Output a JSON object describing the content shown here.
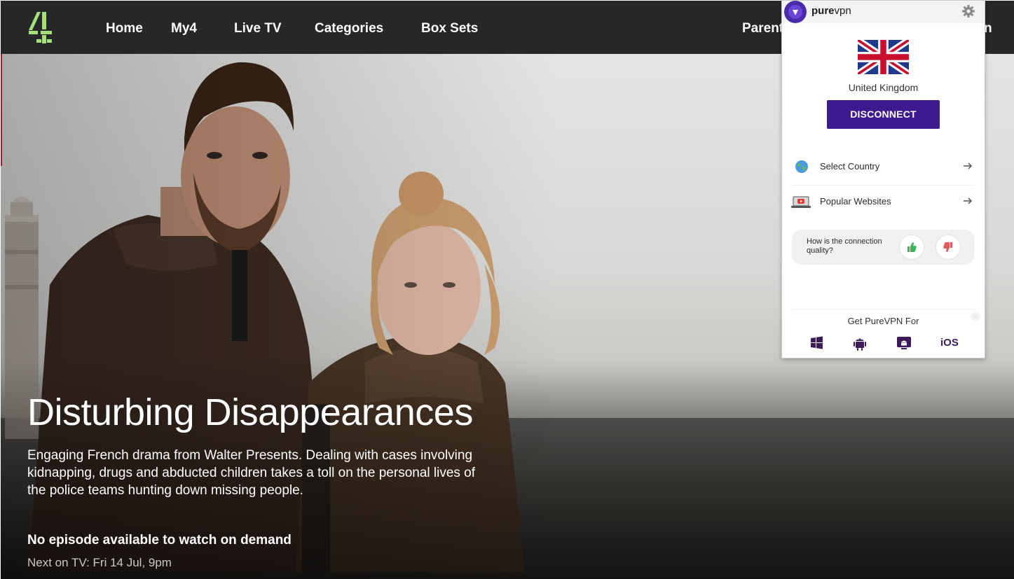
{
  "nav": {
    "brand": "Channel 4",
    "items": [
      "Home",
      "My4",
      "Live TV",
      "Categories",
      "Box Sets",
      "Parent"
    ],
    "trailing_text": "n"
  },
  "hero": {
    "title": "Disturbing Disappearances",
    "description": "Engaging French drama from Walter Presents. Dealing with cases involving kidnapping, drugs and abducted children takes a toll on the personal lives of the police teams hunting down missing people.",
    "status": "No episode available to watch on demand",
    "next_on_tv": "Next on TV: Fri 14 Jul, 9pm"
  },
  "vpn": {
    "brand_bold": "pure",
    "brand_light": "vpn",
    "country": "United Kingdom",
    "disconnect_label": "DISCONNECT",
    "menu": [
      {
        "label": "Select Country",
        "icon": "globe-icon"
      },
      {
        "label": "Popular Websites",
        "icon": "youtube-laptop-icon"
      }
    ],
    "feedback_question": "How is the connection quality?",
    "get_for": "Get PureVPN For",
    "platforms": [
      "windows-icon",
      "android-icon",
      "android-tv-icon"
    ],
    "ios_label": "iOS"
  },
  "colors": {
    "nav_bg": "#252729",
    "channel4_green": "#a6e07a",
    "vpn_purple": "#3d1a8e",
    "thumbs_up": "#3bb55f",
    "thumbs_down": "#e25b5b"
  }
}
